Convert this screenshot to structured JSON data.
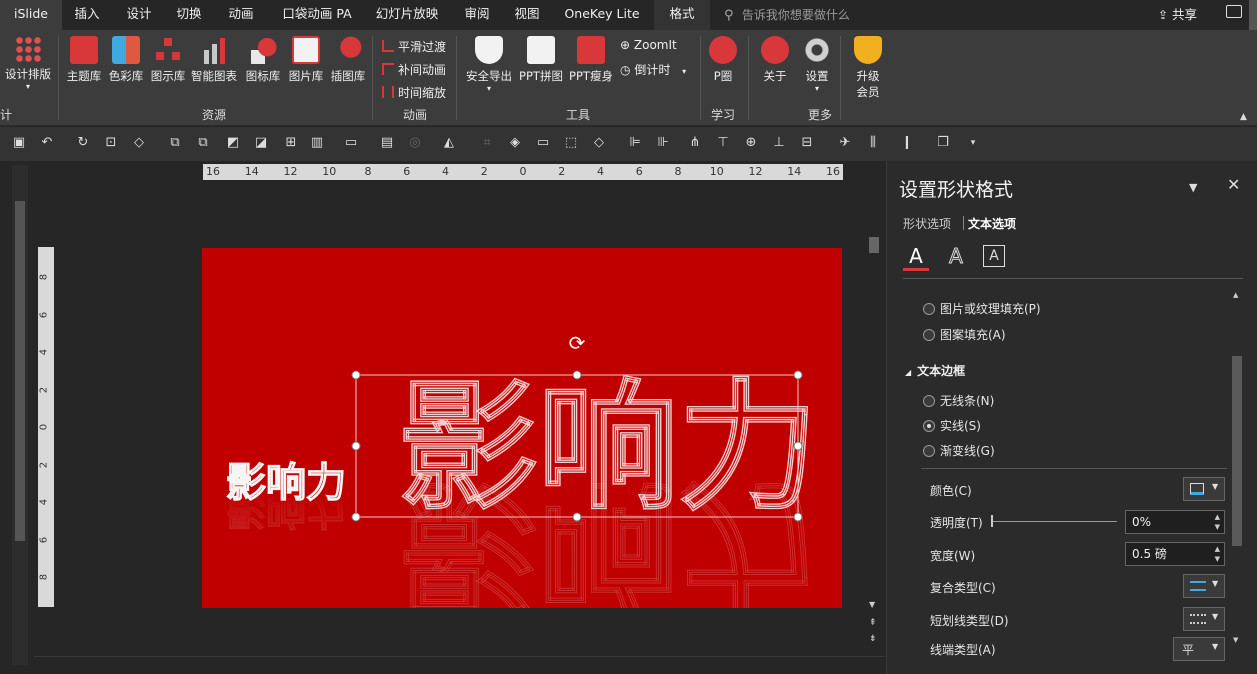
{
  "tabs": [
    {
      "label": "iSlide"
    },
    {
      "label": "插入"
    },
    {
      "label": "设计"
    },
    {
      "label": "切换"
    },
    {
      "label": "动画"
    },
    {
      "label": "口袋动画 PA"
    },
    {
      "label": "幻灯片放映"
    },
    {
      "label": "审阅"
    },
    {
      "label": "视图"
    },
    {
      "label": "OneKey Lite"
    },
    {
      "label": "格式"
    }
  ],
  "search": {
    "placeholder": "告诉我你想要做什么"
  },
  "share": {
    "label": "共享"
  },
  "ribbon": {
    "design_layout": {
      "label": "设计排版"
    },
    "design_group_frag": "计",
    "resources": {
      "group": "资源",
      "items": [
        "主题库",
        "色彩库",
        "图示库",
        "智能图表",
        "图标库",
        "图片库",
        "插图库"
      ]
    },
    "animation": {
      "group": "动画",
      "items": [
        "平滑过渡",
        "补间动画",
        "时间缩放"
      ]
    },
    "tools": {
      "group": "工具",
      "items": [
        "安全导出",
        "PPT拼图",
        "PPT瘦身"
      ],
      "small": [
        "ZoomIt",
        "倒计时"
      ]
    },
    "learn": {
      "group": "学习",
      "item": "P圈"
    },
    "more": {
      "group": "更多",
      "items": [
        "关于",
        "设置"
      ],
      "upgrade_line1": "升级",
      "upgrade_line2": "会员"
    }
  },
  "ruler": {
    "h_ticks": [
      "16",
      "14",
      "12",
      "10",
      "8",
      "6",
      "4",
      "2",
      "0",
      "2",
      "4",
      "6",
      "8",
      "10",
      "12",
      "14",
      "16"
    ],
    "v_ticks": [
      "8",
      "6",
      "4",
      "2",
      "0",
      "2",
      "4",
      "6",
      "8"
    ]
  },
  "slide": {
    "small_text": "影响力",
    "big_text": "影响力",
    "background": "#c00000"
  },
  "pane": {
    "title": "设置形状格式",
    "tab_shape": "形状选项",
    "tab_text": "文本选项",
    "fill_options": [
      "图片或纹理填充(P)",
      "图案填充(A)"
    ],
    "border_section": "文本边框",
    "border_options": [
      {
        "label": "无线条(N)",
        "selected": false
      },
      {
        "label": "实线(S)",
        "selected": true
      },
      {
        "label": "渐变线(G)",
        "selected": false
      }
    ],
    "props": {
      "color": "颜色(C)",
      "transparency": "透明度(T)",
      "transparency_value": "0%",
      "width": "宽度(W)",
      "width_value": "0.5 磅",
      "compound": "复合类型(C)",
      "dash": "短划线类型(D)",
      "cap": "线端类型(A)",
      "cap_value": "平"
    }
  }
}
